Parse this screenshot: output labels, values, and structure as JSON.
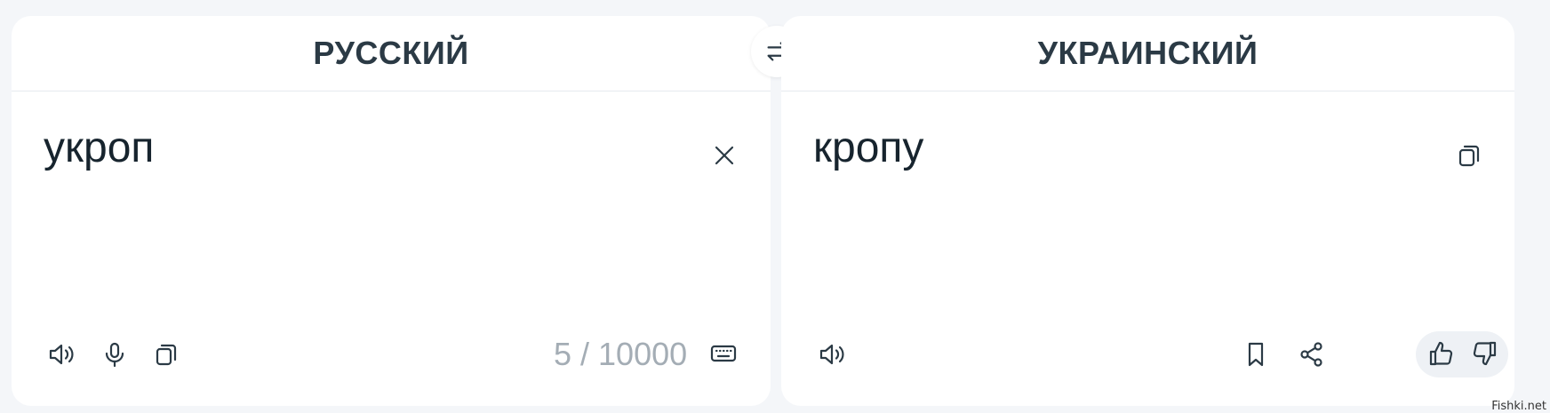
{
  "source": {
    "language": "РУССКИЙ",
    "text": "укроп",
    "counter": "5 / 10000"
  },
  "target": {
    "language": "УКРАИНСКИЙ",
    "text": "кропу"
  },
  "icons": {
    "swap": "swap-arrows-icon",
    "clear": "close-icon",
    "speaker": "speaker-icon",
    "mic": "microphone-icon",
    "copy": "copy-icon",
    "keyboard": "keyboard-icon",
    "bookmark": "bookmark-icon",
    "share": "share-icon",
    "like": "thumbs-up-icon",
    "dislike": "thumbs-down-icon"
  },
  "watermark": "Fishki.net"
}
